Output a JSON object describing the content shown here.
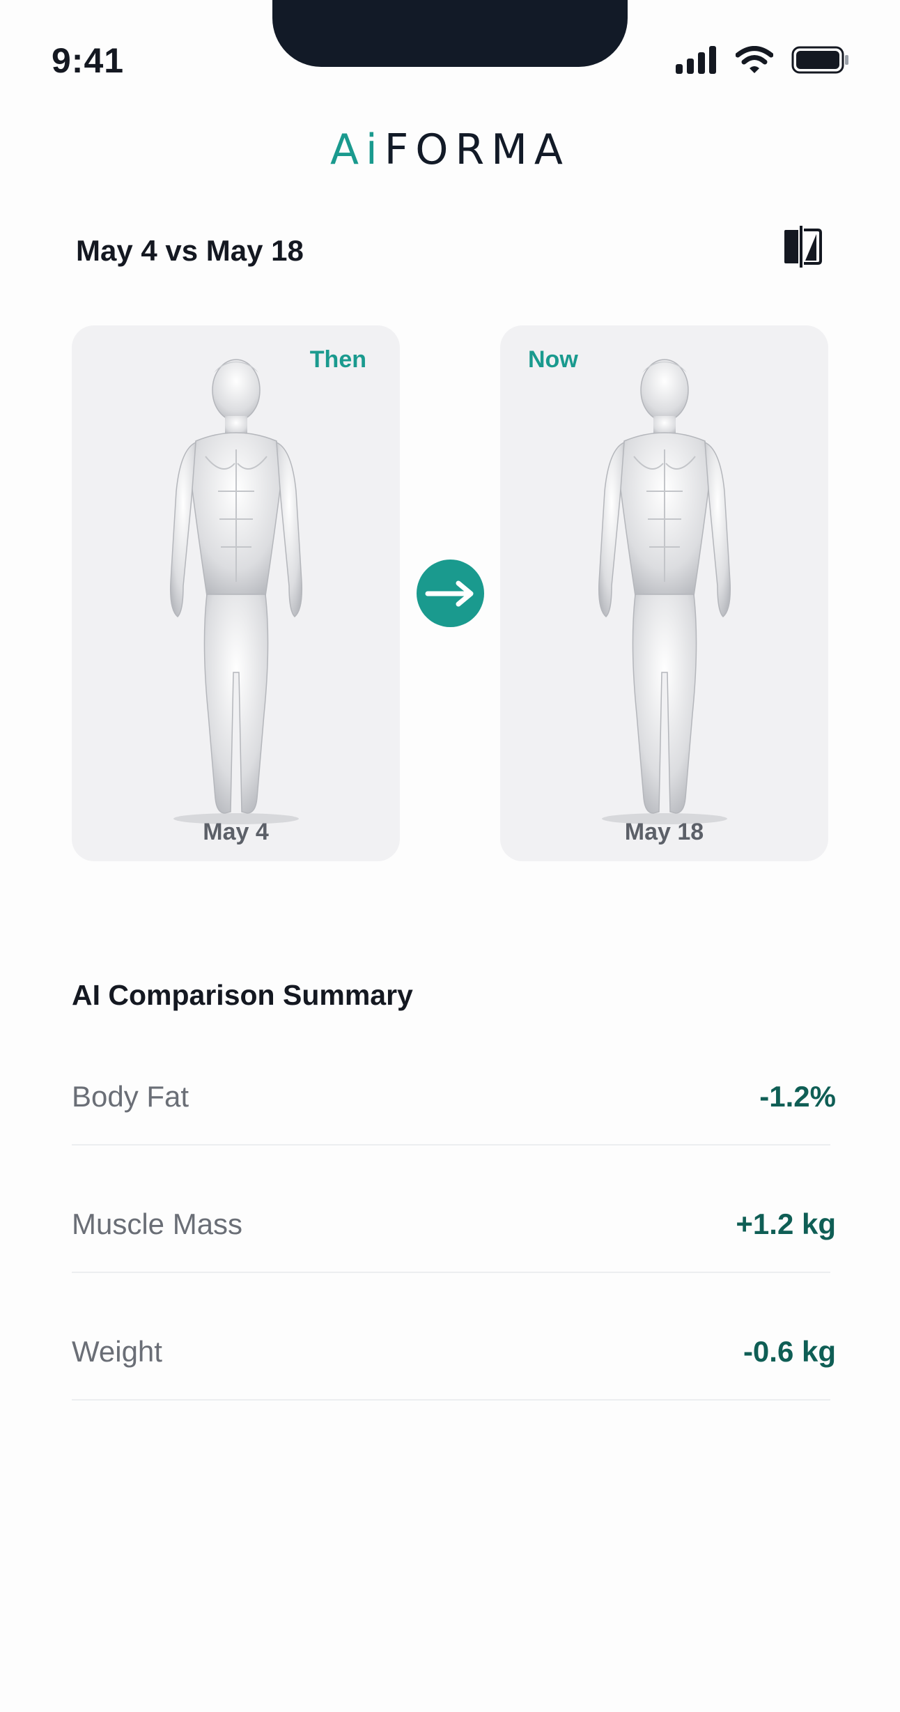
{
  "status_bar": {
    "time": "9:41",
    "icons": [
      "signal-icon",
      "wifi-icon",
      "battery-icon"
    ]
  },
  "brand": {
    "logo_accent": "Ai",
    "logo_rest": "FORMA",
    "accent_color": "#1a9a8e"
  },
  "header": {
    "title": "May 4 vs May 18",
    "toggle_icon": "compare-icon"
  },
  "comparison": {
    "then": {
      "tag": "Then",
      "date": "May 4"
    },
    "arrow_icon": "arrow-right-icon",
    "now": {
      "tag": "Now",
      "date": "May 18"
    }
  },
  "summary": {
    "title": "AI Comparison Summary",
    "metrics": [
      {
        "label": "Body Fat",
        "value": "-1.2%"
      },
      {
        "label": "Muscle Mass",
        "value": "+1.2 kg"
      },
      {
        "label": "Weight",
        "value": "-0.6 kg"
      }
    ],
    "value_color": "#0f5e55"
  }
}
